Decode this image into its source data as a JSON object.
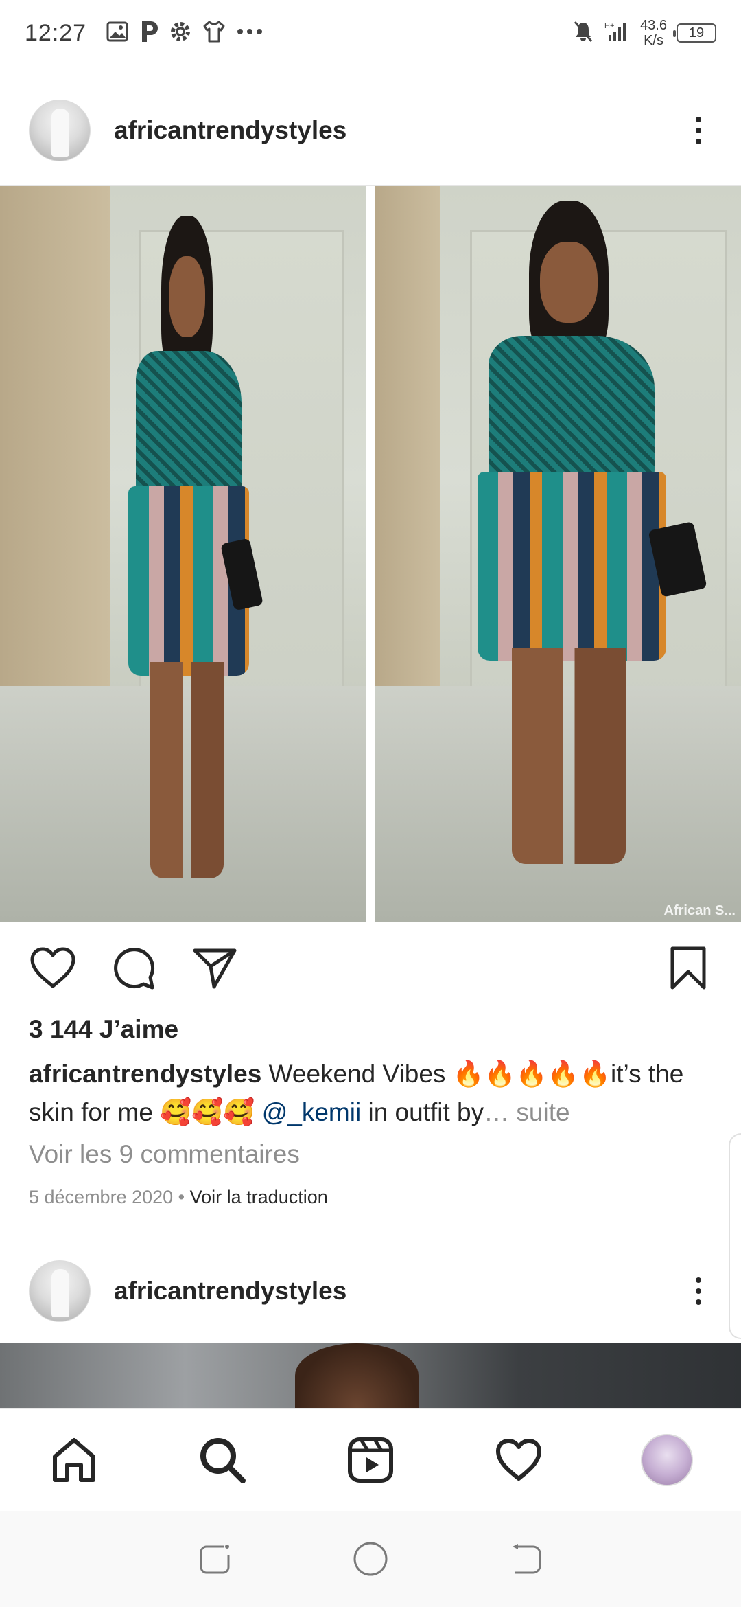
{
  "status_bar": {
    "time": "12:27",
    "left_icons": [
      "image-icon",
      "p-icon",
      "gear-icon",
      "shirt-icon",
      "more-dots-icon"
    ],
    "network_speed_value": "43.6",
    "network_speed_unit": "K/s",
    "battery": "19"
  },
  "post": {
    "username": "africantrendystyles",
    "image_watermark": "African S...",
    "likes": "3 144 J’aime",
    "caption_user": "africantrendystyles",
    "caption_text_1": " Weekend Vibes 🔥🔥🔥🔥🔥it’s the skin for me 🥰🥰🥰 ",
    "caption_mention": "@_kemii",
    "caption_text_2": " in outfit by",
    "caption_more": "… suite",
    "comments_link": "Voir les 9 commentaires",
    "date": "5 décembre 2020",
    "separator": " • ",
    "translate": "Voir la traduction"
  },
  "next_post": {
    "username": "africantrendystyles"
  },
  "colors": {
    "text": "#262626",
    "secondary": "#8e8e8e",
    "mention": "#00376b"
  }
}
